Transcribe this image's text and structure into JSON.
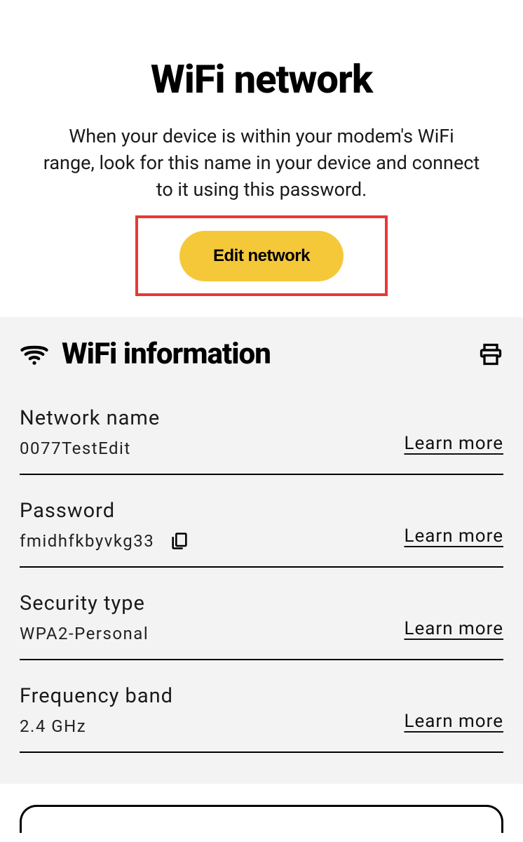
{
  "header": {
    "title": "WiFi network",
    "description": "When your device is within your modem's WiFi range, look for this name in your device and connect to it using this password.",
    "edit_button_label": "Edit network"
  },
  "section": {
    "title": "WiFi information",
    "learn_more_label": "Learn more",
    "rows": [
      {
        "label": "Network name",
        "value": "0077TestEdit",
        "has_copy": false
      },
      {
        "label": "Password",
        "value": "fmidhfkbyvkg33",
        "has_copy": true
      },
      {
        "label": "Security type",
        "value": "WPA2-Personal",
        "has_copy": false
      },
      {
        "label": "Frequency band",
        "value": "2.4 GHz",
        "has_copy": false
      }
    ]
  }
}
